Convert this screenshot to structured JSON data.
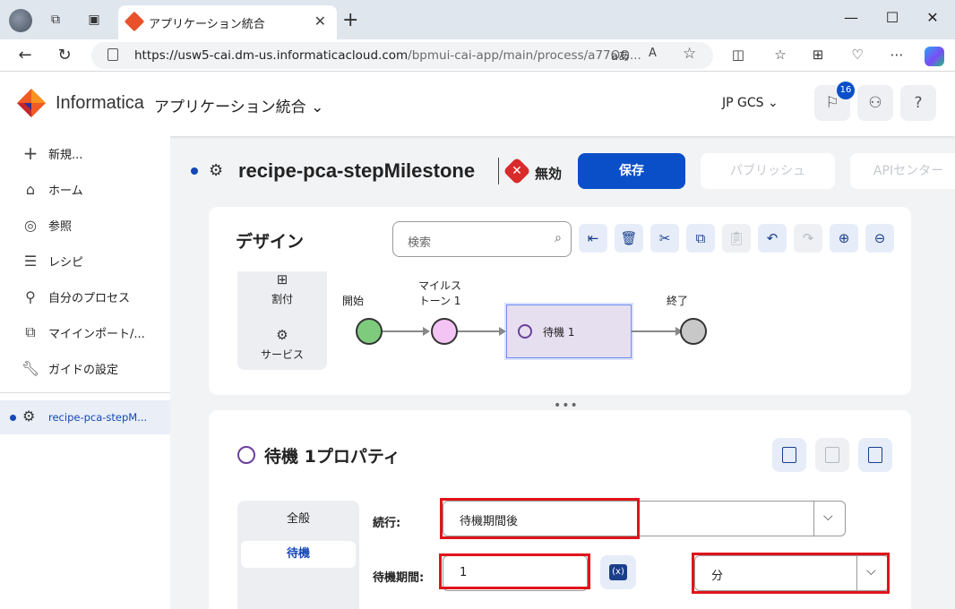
{
  "browser": {
    "tab_title": "アプリケーション統合",
    "url_host": "https://usw5-cai.dm-us.informaticacloud.com",
    "url_path": "/bpmui-cai-app/main/process/a77OQ...",
    "read_aloud": "A̅",
    "translate": "aあ"
  },
  "header": {
    "brand": "Informatica",
    "app_name": "アプリケーション統合",
    "org": "JP GCS",
    "notification_count": "16",
    "help_label": "?"
  },
  "sidebar": {
    "items": [
      {
        "label": "新規...",
        "icon": "plus-icon"
      },
      {
        "label": "ホーム",
        "icon": "home-icon"
      },
      {
        "label": "参照",
        "icon": "compass-icon"
      },
      {
        "label": "レシピ",
        "icon": "recipe-icon"
      },
      {
        "label": "自分のプロセス",
        "icon": "process-icon"
      },
      {
        "label": "マイインポート/...",
        "icon": "import-icon"
      },
      {
        "label": "ガイドの設定",
        "icon": "wrench-icon"
      }
    ],
    "active_process": "recipe-pca-stepM..."
  },
  "process": {
    "title": "recipe-pca-stepMilestone",
    "status": "無効",
    "save_label": "保存",
    "publish_label": "パブリッシュ",
    "api_label": "APIセンター"
  },
  "design": {
    "title": "デザイン",
    "search_placeholder": "検索",
    "toolbar": [
      "align-left-icon",
      "trash-icon",
      "scissors-icon",
      "copy-icon",
      "paste-icon",
      "undo-icon",
      "redo-icon",
      "zoom-in-icon",
      "zoom-out-icon"
    ],
    "palette": [
      {
        "label": "割付",
        "icon": "assignment-icon"
      },
      {
        "label": "サービス",
        "icon": "service-icon"
      }
    ],
    "nodes": {
      "start": "開始",
      "milestone_line1": "マイルス",
      "milestone_line2": "トーン 1",
      "wait": "待機 1",
      "end": "終了"
    },
    "colors": {
      "start": "#7ecb7e",
      "milestone": "#f4c4f4",
      "end": "#c8c8c8"
    }
  },
  "properties": {
    "title": "待機 1プロパティ",
    "tabs": [
      "全般",
      "待機"
    ],
    "active_tab": "待機",
    "continue_label": "続行:",
    "continue_value": "待機期間後",
    "duration_label": "待機期間:",
    "duration_value": "1",
    "variable_label": "(x)",
    "unit_value": "分"
  }
}
